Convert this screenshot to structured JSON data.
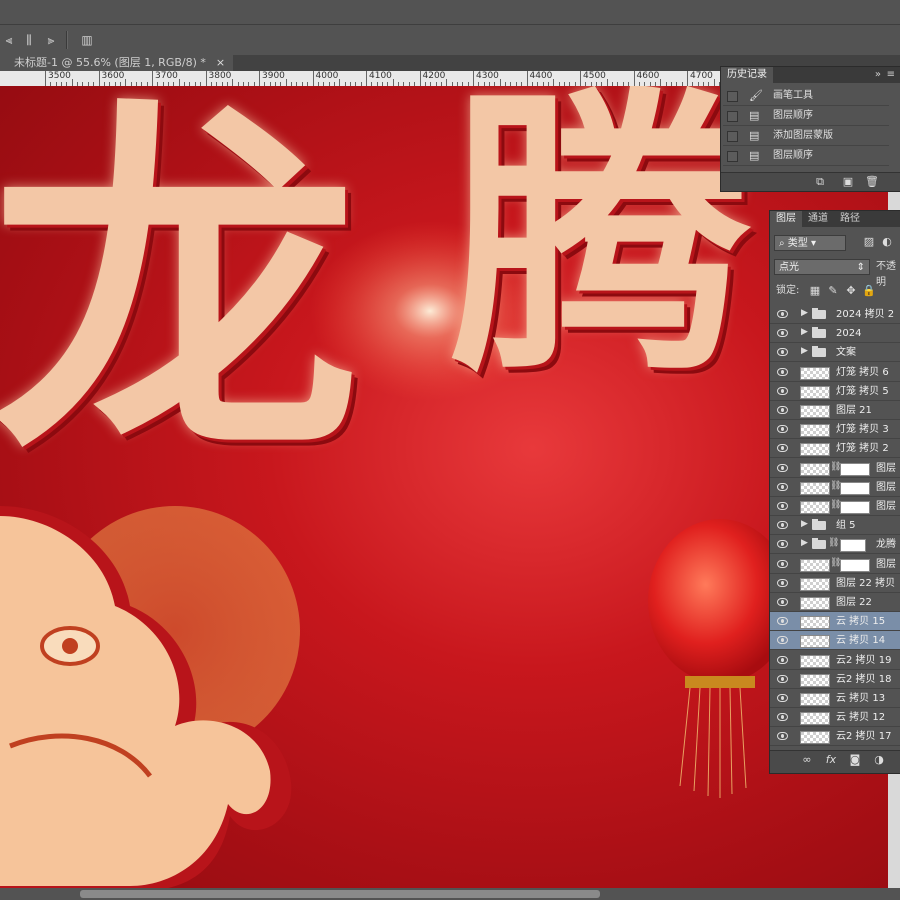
{
  "document": {
    "tab_title": "未标题-1 @ 55.6% (图层 1, RGB/8) *",
    "close_glyph": "×"
  },
  "ruler": {
    "ticks": [
      "3500",
      "3600",
      "3700",
      "3800",
      "3900",
      "4000",
      "4100",
      "4200",
      "4300",
      "4400",
      "4500",
      "4600",
      "4700"
    ]
  },
  "canvas": {
    "art_chars": [
      "龙",
      "腾"
    ],
    "colors": {
      "bg": "#c8171d",
      "text": "#f3c7a6",
      "dragon": "#f6c49a"
    }
  },
  "history_panel": {
    "title": "历史记录",
    "menu_glyph": "≡",
    "collapse_glyph": "»",
    "items": [
      {
        "label": "画笔工具",
        "icon": "brush-icon"
      },
      {
        "label": "图层顺序",
        "icon": "document-icon"
      },
      {
        "label": "添加图层蒙版",
        "icon": "document-icon"
      },
      {
        "label": "图层顺序",
        "icon": "document-icon"
      }
    ]
  },
  "layers_panel": {
    "tabs": [
      "图层",
      "通道",
      "路径"
    ],
    "filter_label": "类型",
    "blend_mode": "点光",
    "opacity_label": "不透明",
    "lock_label": "锁定:",
    "layers": [
      {
        "name": "2024 拷贝 2",
        "kind": "group",
        "selected": false
      },
      {
        "name": "2024",
        "kind": "group",
        "selected": false
      },
      {
        "name": "文案",
        "kind": "group",
        "selected": false
      },
      {
        "name": "灯笼 拷贝 6",
        "kind": "pixel",
        "selected": false
      },
      {
        "name": "灯笼 拷贝 5",
        "kind": "pixel",
        "selected": false
      },
      {
        "name": "图层 21",
        "kind": "pixel",
        "selected": false
      },
      {
        "name": "灯笼 拷贝 3",
        "kind": "pixel",
        "selected": false
      },
      {
        "name": "灯笼 拷贝 2",
        "kind": "pixel",
        "selected": false
      },
      {
        "name": "图层",
        "kind": "masked",
        "selected": false
      },
      {
        "name": "图层",
        "kind": "masked",
        "selected": false
      },
      {
        "name": "图层",
        "kind": "masked",
        "selected": false
      },
      {
        "name": "组 5",
        "kind": "group",
        "selected": false
      },
      {
        "name": "龙腾",
        "kind": "group-masked",
        "selected": false
      },
      {
        "name": "图层",
        "kind": "masked",
        "selected": false
      },
      {
        "name": "图层 22 拷贝",
        "kind": "pixel",
        "selected": false
      },
      {
        "name": "图层 22",
        "kind": "pixel",
        "selected": false
      },
      {
        "name": "云 拷贝 15",
        "kind": "pixel",
        "selected": true
      },
      {
        "name": "云 拷贝 14",
        "kind": "pixel",
        "selected": true
      },
      {
        "name": "云2 拷贝 19",
        "kind": "pixel",
        "selected": false
      },
      {
        "name": "云2 拷贝 18",
        "kind": "pixel",
        "selected": false
      },
      {
        "name": "云 拷贝 13",
        "kind": "pixel",
        "selected": false
      },
      {
        "name": "云 拷贝 12",
        "kind": "pixel",
        "selected": false
      },
      {
        "name": "云2 拷贝 17",
        "kind": "pixel",
        "selected": false
      }
    ]
  }
}
